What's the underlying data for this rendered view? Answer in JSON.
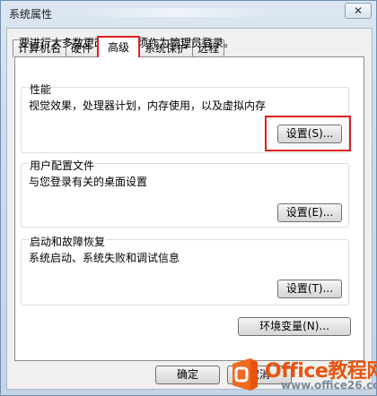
{
  "window": {
    "title": "系统属性",
    "close_glyph": "✕"
  },
  "tabs": [
    {
      "label": "计算机名",
      "active": false
    },
    {
      "label": "硬件",
      "active": false
    },
    {
      "label": "高级",
      "active": true
    },
    {
      "label": "系统保护",
      "active": false
    },
    {
      "label": "远程",
      "active": false
    }
  ],
  "notice": "要进行大多数更改，您必须作为管理员登录。",
  "performance": {
    "label": "性能",
    "description": "视觉效果，处理器计划，内存使用，以及虚拟内存",
    "button": "设置(S)..."
  },
  "user_profiles": {
    "label": "用户配置文件",
    "description": "与您登录有关的桌面设置",
    "button": "设置(E)..."
  },
  "startup_recovery": {
    "label": "启动和故障恢复",
    "description": "系统启动、系统失败和调试信息",
    "button": "设置(T)..."
  },
  "env_button": "环境变量(N)...",
  "footer": {
    "ok": "确定",
    "cancel": "取消"
  },
  "watermark": {
    "brand": "Office教程网",
    "url": "www.office26.com"
  },
  "colors": {
    "highlight": "#e02020",
    "brand": "#e8540e"
  }
}
